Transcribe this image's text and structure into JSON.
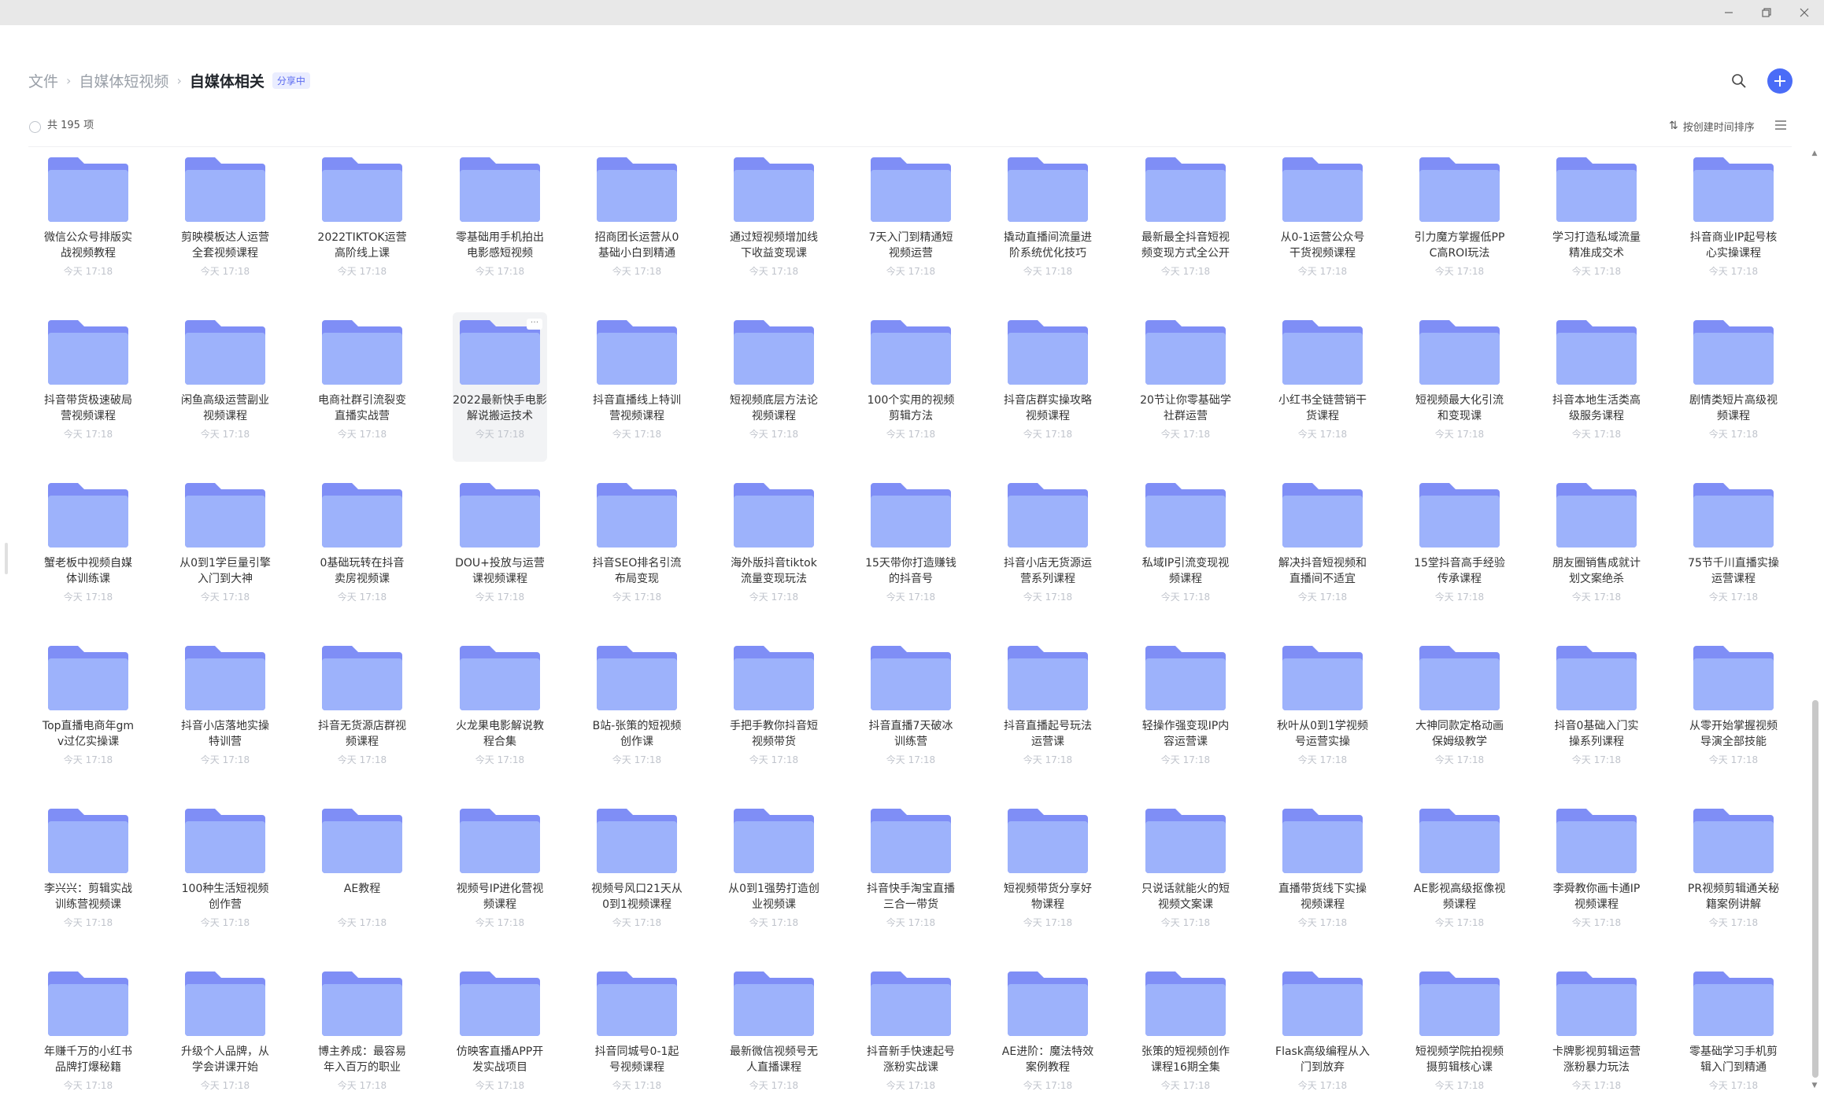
{
  "window": {
    "minimize_icon": "minimize-icon",
    "maximize_icon": "restore-icon",
    "close_icon": "close-icon"
  },
  "breadcrumb": {
    "items": [
      "文件",
      "自媒体短视频",
      "自媒体相关"
    ],
    "share_badge": "分享中"
  },
  "toolbar": {
    "count_text": "共 195 项",
    "sort_label": "按创建时间排序"
  },
  "colors": {
    "accent": "#4a6cf7",
    "folder_back": "#7f8ef6",
    "folder_front": "#9db2fb"
  },
  "folders": [
    {
      "name": "微信公众号排版实战视频教程",
      "time": "今天 17:18"
    },
    {
      "name": "剪映模板达人运营全套视频课程",
      "time": "今天 17:18"
    },
    {
      "name": "2022TIKTOK运营高阶线上课",
      "time": "今天 17:18"
    },
    {
      "name": "零基础用手机拍出电影感短视频",
      "time": "今天 17:18"
    },
    {
      "name": "招商团长运营从0基础小白到精通",
      "time": "今天 17:18"
    },
    {
      "name": "通过短视频增加线下收益变现课",
      "time": "今天 17:18"
    },
    {
      "name": "7天入门到精通短视频运营",
      "time": "今天 17:18"
    },
    {
      "name": "撬动直播间流量进阶系统优化技巧",
      "time": "今天 17:18"
    },
    {
      "name": "最新最全抖音短视频变现方式全公开",
      "time": "今天 17:18"
    },
    {
      "name": "从0-1运营公众号干货视频课程",
      "time": "今天 17:18"
    },
    {
      "name": "引力魔方掌握低PPC高ROI玩法",
      "time": "今天 17:18"
    },
    {
      "name": "学习打造私域流量精准成交术",
      "time": "今天 17:18"
    },
    {
      "name": "抖音商业IP起号核心实操课程",
      "time": "今天 17:18"
    },
    {
      "name": "抖音带货极速破局营视频课程",
      "time": "今天 17:18"
    },
    {
      "name": "闲鱼高级运营副业视频课程",
      "time": "今天 17:18"
    },
    {
      "name": "电商社群引流裂变直播实战营",
      "time": "今天 17:18"
    },
    {
      "name": "2022最新快手电影解说搬运技术",
      "time": "今天 17:18"
    },
    {
      "name": "抖音直播线上特训营视频课程",
      "time": "今天 17:18"
    },
    {
      "name": "短视频底层方法论视频课程",
      "time": "今天 17:18"
    },
    {
      "name": "100个实用的视频剪辑方法",
      "time": "今天 17:18"
    },
    {
      "name": "抖音店群实操攻略视频课程",
      "time": "今天 17:18"
    },
    {
      "name": "20节让你零基础学社群运营",
      "time": "今天 17:18"
    },
    {
      "name": "小红书全链营销干货课程",
      "time": "今天 17:18"
    },
    {
      "name": "短视频最大化引流和变现课",
      "time": "今天 17:18"
    },
    {
      "name": "抖音本地生活类高级服务课程",
      "time": "今天 17:18"
    },
    {
      "name": "剧情类短片高级视频课程",
      "time": "今天 17:18"
    },
    {
      "name": "蟹老板中视频自媒体训练课",
      "time": "今天 17:18"
    },
    {
      "name": "从0到1学巨量引擎入门到大神",
      "time": "今天 17:18"
    },
    {
      "name": "0基础玩转在抖音卖房视频课",
      "time": "今天 17:18"
    },
    {
      "name": "DOU+投放与运营课视频课程",
      "time": "今天 17:18"
    },
    {
      "name": "抖音SEO排名引流布局变现",
      "time": "今天 17:18"
    },
    {
      "name": "海外版抖音tiktok流量变现玩法",
      "time": "今天 17:18"
    },
    {
      "name": "15天带你打造赚钱的抖音号",
      "time": "今天 17:18"
    },
    {
      "name": "抖音小店无货源运营系列课程",
      "time": "今天 17:18"
    },
    {
      "name": "私域IP引流变现视频课程",
      "time": "今天 17:18"
    },
    {
      "name": "解决抖音短视频和直播间不适宜",
      "time": "今天 17:18"
    },
    {
      "name": "15堂抖音高手经验传承课程",
      "time": "今天 17:18"
    },
    {
      "name": "朋友圈销售成就计划文案绝杀",
      "time": "今天 17:18"
    },
    {
      "name": "75节千川直播实操运营课程",
      "time": "今天 17:18"
    },
    {
      "name": "Top直播电商年gmv过亿实操课",
      "time": "今天 17:18"
    },
    {
      "name": "抖音小店落地实操特训营",
      "time": "今天 17:18"
    },
    {
      "name": "抖音无货源店群视频课程",
      "time": "今天 17:18"
    },
    {
      "name": "火龙果电影解说教程合集",
      "time": "今天 17:18"
    },
    {
      "name": "B站-张策的短视频创作课",
      "time": "今天 17:18"
    },
    {
      "name": "手把手教你抖音短视频带货",
      "time": "今天 17:18"
    },
    {
      "name": "抖音直播7天破冰训练营",
      "time": "今天 17:18"
    },
    {
      "name": "抖音直播起号玩法运营课",
      "time": "今天 17:18"
    },
    {
      "name": "轻操作强变现IP内容运营课",
      "time": "今天 17:18"
    },
    {
      "name": "秋叶从0到1学视频号运营实操",
      "time": "今天 17:18"
    },
    {
      "name": "大神同款定格动画保姆级教学",
      "time": "今天 17:18"
    },
    {
      "name": "抖音0基础入门实操系列课程",
      "time": "今天 17:18"
    },
    {
      "name": "从零开始掌握视频导演全部技能",
      "time": "今天 17:18"
    },
    {
      "name": "李兴兴：剪辑实战训练营视频课",
      "time": "今天 17:18"
    },
    {
      "name": "100种生活短视频创作营",
      "time": "今天 17:18"
    },
    {
      "name": "AE教程",
      "time": "今天 17:18"
    },
    {
      "name": "视频号IP进化营视频课程",
      "time": "今天 17:18"
    },
    {
      "name": "视频号风口21天从0到1视频课程",
      "time": "今天 17:18"
    },
    {
      "name": "从0到1强势打造创业视频课",
      "time": "今天 17:18"
    },
    {
      "name": "抖音快手淘宝直播三合一带货",
      "time": "今天 17:18"
    },
    {
      "name": "短视频带货分享好物课程",
      "time": "今天 17:18"
    },
    {
      "name": "只说话就能火的短视频文案课",
      "time": "今天 17:18"
    },
    {
      "name": "直播带货线下实操视频课程",
      "time": "今天 17:18"
    },
    {
      "name": "AE影视高级抠像视频课程",
      "time": "今天 17:18"
    },
    {
      "name": "李舜教你画卡通IP视频课程",
      "time": "今天 17:18"
    },
    {
      "name": "PR视频剪辑通关秘籍案例讲解",
      "time": "今天 17:18"
    },
    {
      "name": "年赚千万的小红书品牌打爆秘籍",
      "time": "今天 17:18"
    },
    {
      "name": "升级个人品牌，从学会讲课开始",
      "time": "今天 17:18"
    },
    {
      "name": "博主养成：最容易年入百万的职业",
      "time": "今天 17:18"
    },
    {
      "name": "仿映客直播APP开发实战项目",
      "time": "今天 17:18"
    },
    {
      "name": "抖音同城号0-1起号视频课程",
      "time": "今天 17:18"
    },
    {
      "name": "最新微信视频号无人直播课程",
      "time": "今天 17:18"
    },
    {
      "name": "抖音新手快速起号涨粉实战课",
      "time": "今天 17:18"
    },
    {
      "name": "AE进阶：魔法特效案例教程",
      "time": "今天 17:18"
    },
    {
      "name": "张策的短视频创作课程16期全集",
      "time": "今天 17:18"
    },
    {
      "name": "Flask高级编程从入门到放弃",
      "time": "今天 17:18"
    },
    {
      "name": "短视频学院拍视频摄剪辑核心课",
      "time": "今天 17:18"
    },
    {
      "name": "卡牌影视剪辑运营涨粉暴力玩法",
      "time": "今天 17:18"
    },
    {
      "name": "零基础学习手机剪辑入门到精通",
      "time": "今天 17:18"
    }
  ]
}
